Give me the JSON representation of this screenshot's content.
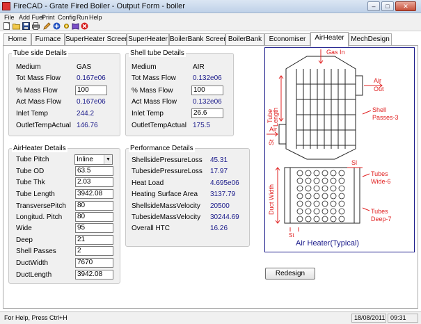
{
  "window": {
    "title": "FireCAD - Grate Fired Boiler - Output Form - boiler"
  },
  "menu": [
    "File",
    "Add Fuel",
    "Print",
    "Config",
    "Run",
    "Help"
  ],
  "tabs": [
    "Home",
    "Furnace",
    "SuperHeater Screen",
    "SuperHeater",
    "BoilerBank Screen",
    "BoilerBank",
    "Economiser",
    "AirHeater",
    "MechDesign"
  ],
  "active_tab": "AirHeater",
  "tube_side": {
    "title": "Tube side Details",
    "rows": [
      {
        "label": "Medium",
        "value": "GAS"
      },
      {
        "label": "Tot Mass Flow",
        "value": "0.167e06"
      },
      {
        "label": "% Mass Flow",
        "value": "100"
      },
      {
        "label": "Act Mass Flow",
        "value": "0.167e06"
      },
      {
        "label": "Inlet Temp",
        "value": "244.2"
      },
      {
        "label": "OutletTempActual",
        "value": "146.76"
      }
    ]
  },
  "shell_side": {
    "title": "Shell tube Details",
    "rows": [
      {
        "label": "Medium",
        "value": "AIR"
      },
      {
        "label": "Tot Mass Flow",
        "value": "0.132e06"
      },
      {
        "label": "% Mass Flow",
        "value": "100"
      },
      {
        "label": "Act Mass Flow",
        "value": "0.132e06"
      },
      {
        "label": "Inlet Temp",
        "value": "26.6"
      },
      {
        "label": "OutletTempActual",
        "value": "175.5"
      }
    ]
  },
  "airheater": {
    "title": "AirHeater Details",
    "rows": [
      {
        "label": "Tube Pitch",
        "value": "Inline"
      },
      {
        "label": "Tube OD",
        "value": "63.5"
      },
      {
        "label": "Tube Thk",
        "value": "2.03"
      },
      {
        "label": "Tube Length",
        "value": "3942.08"
      },
      {
        "label": "TransversePitch",
        "value": "80"
      },
      {
        "label": "Longitud. Pitch",
        "value": "80"
      },
      {
        "label": "Wide",
        "value": "95"
      },
      {
        "label": "Deep",
        "value": "21"
      },
      {
        "label": "Shell Passes",
        "value": "2"
      },
      {
        "label": "DuctWidth",
        "value": "7670"
      },
      {
        "label": "DuctLength",
        "value": "3942.08"
      }
    ]
  },
  "performance": {
    "title": "Performance Details",
    "rows": [
      {
        "label": "ShellsidePressureLoss",
        "value": "45.31"
      },
      {
        "label": "TubesidePressureLoss",
        "value": "17.97"
      },
      {
        "label": "Heat Load",
        "value": "4.695e06"
      },
      {
        "label": "Heating Surface Area",
        "value": "3137.79"
      },
      {
        "label": "ShellsideMassVelocity",
        "value": "20500"
      },
      {
        "label": "TubesideMassVelocity",
        "value": "30244.69"
      },
      {
        "label": "Overall HTC",
        "value": "16.26"
      }
    ]
  },
  "diagram": {
    "gas_in": "Gas In",
    "air_out_1": "Air",
    "air_out_2": "Out",
    "tube_length_1": "Tube",
    "tube_length_2": "Length",
    "shell_1": "Shell",
    "shell_2": "Passes-3",
    "air_in": "Air",
    "st_left": "St",
    "sl": "Sl",
    "duct_width": "Duct Width",
    "tubes_wide_1": "Tubes",
    "tubes_wide_2": "Wide-6",
    "tubes_deep_1": "Tubes",
    "tubes_deep_2": "Deep-7",
    "st_bottom": "St",
    "caption": "Air Heater(Typical)"
  },
  "redesign_label": "Redesign",
  "status": {
    "help": "For Help, Press Ctrl+H",
    "date": "18/08/2011",
    "time": "09:31"
  },
  "colors": {
    "diagram_red": "#e02020",
    "value_blue": "#1a1a8a"
  }
}
